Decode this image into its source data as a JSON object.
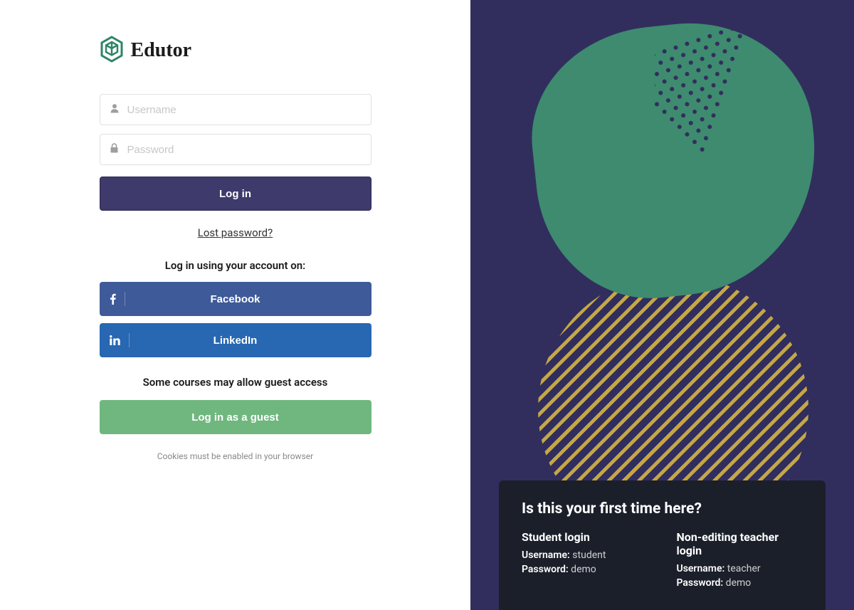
{
  "brand": {
    "name": "Edutor"
  },
  "form": {
    "username_placeholder": "Username",
    "password_placeholder": "Password",
    "login_button": "Log in",
    "lost_password_link": "Lost password?"
  },
  "social": {
    "heading": "Log in using your account on:",
    "facebook_label": "Facebook",
    "linkedin_label": "LinkedIn"
  },
  "guest": {
    "note": "Some courses may allow guest access",
    "button": "Log in as a guest"
  },
  "footer": {
    "cookies_note": "Cookies must be enabled in your browser"
  },
  "info_card": {
    "title": "Is this your first time here?",
    "columns": [
      {
        "title": "Student login",
        "username_label": "Username:",
        "username_value": "student",
        "password_label": "Password:",
        "password_value": "demo"
      },
      {
        "title": "Non-editing teacher login",
        "username_label": "Username:",
        "username_value": "teacher",
        "password_label": "Password:",
        "password_value": "demo"
      }
    ]
  },
  "colors": {
    "primary_dark": "#312e5e",
    "button_primary": "#3e3a6b",
    "accent_green": "#3e8b6f",
    "guest_green": "#6fb77f",
    "facebook": "#3e5a99",
    "linkedin": "#2867b2",
    "gold": "#c4a747",
    "card_dark": "#1b1f2a"
  }
}
